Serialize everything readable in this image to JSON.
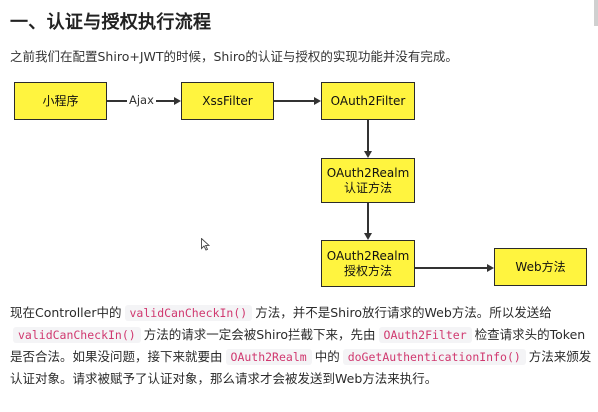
{
  "heading": "一、认证与授权执行流程",
  "intro": "之前我们在配置Shiro+JWT的时候，Shiro的认证与授权的实现功能并没有完成。",
  "flow": {
    "node_mini": "小程序",
    "edge_ajax": "Ajax",
    "node_xss": "XssFilter",
    "node_oauth_filter": "OAuth2Filter",
    "node_realm_auth_line1": "OAuth2Realm",
    "node_realm_auth_line2": "认证方法",
    "node_realm_perm_line1": "OAuth2Realm",
    "node_realm_perm_line2": "授权方法",
    "node_web": "Web方法"
  },
  "paragraph": {
    "t1": "现在Controller中的",
    "c1": "validCanCheckIn()",
    "t2": "方法，并不是Shiro放行请求的Web方法。所以发送给",
    "c2": "validCanCheckIn()",
    "t3": "方法的请求一定会被Shiro拦截下来，先由",
    "c3": "OAuth2Filter",
    "t4": "检查请求头的Token是否合法。如果没问题，接下来就要由",
    "c4": "OAuth2Realm",
    "t5": "中的",
    "c5": "doGetAuthenticationInfo()",
    "t6": "方法来颁发认证对象。请求被赋予了认证对象，那么请求才会被发送到Web方法来执行。"
  },
  "colors": {
    "box_fill": "#fff43f",
    "code_text": "#d0386f",
    "code_bg": "#f4f4f6"
  }
}
